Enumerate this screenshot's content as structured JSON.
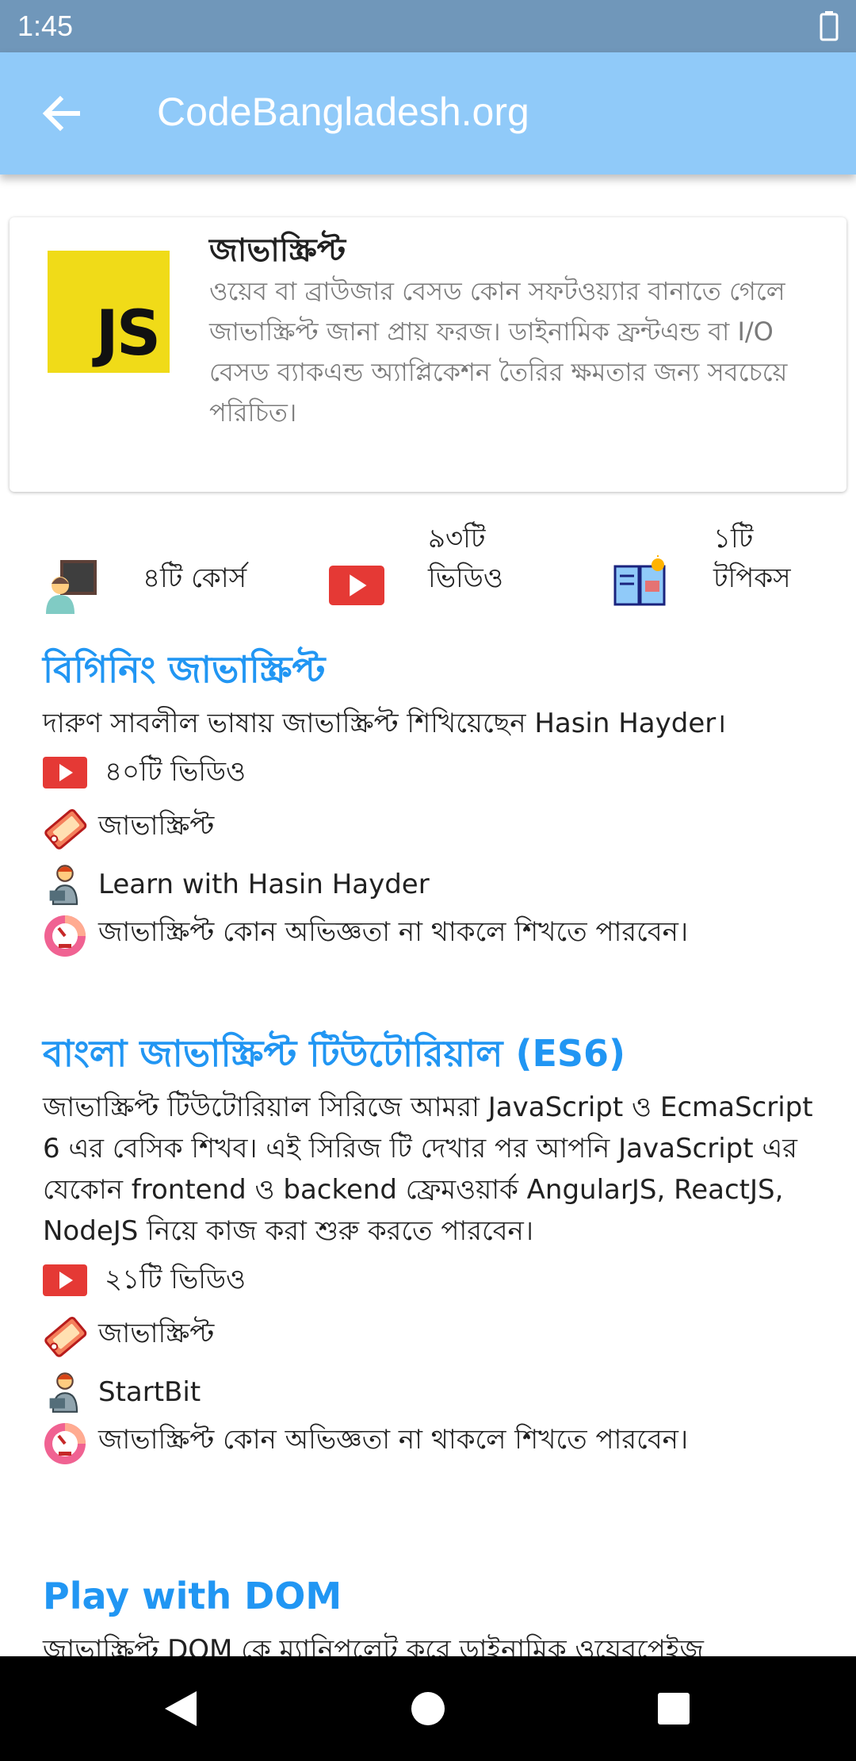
{
  "status_bar": {
    "time": "1:45",
    "battery_icon": "battery-icon"
  },
  "app_bar": {
    "back_icon": "arrow-back-icon",
    "title": "CodeBangladesh.org"
  },
  "intro": {
    "logo_text": "JS",
    "title": "জাভাস্ক্রিপ্ট",
    "description": "ওয়েব বা ব্রাউজার বেসড কোন সফটওয়্যার বানাতে গেলে জাভাস্ক্রিপ্ট জানা প্রায় ফরজ। ডাইনামিক ফ্রন্টএন্ড বা I/O বেসড ব্যাকএন্ড অ্যাপ্লিকেশন তৈরির ক্ষমতার জন্য সবচেয়ে পরিচিত।"
  },
  "stats": [
    {
      "icon": "teacher-icon",
      "label": "৪টি কোর্স"
    },
    {
      "icon": "youtube-icon",
      "label": "৯৩টি ভিডিও"
    },
    {
      "icon": "book-idea-icon",
      "label": "১টি টপিকস"
    }
  ],
  "courses": [
    {
      "title": "বিগিনিং জাভাস্ক্রিপ্ট",
      "description": "দারুণ সাবলীল ভাষায় জাভাস্ক্রিপ্ট শিখিয়েছেন Hasin Hayder।",
      "videos": "৪০টি ভিডিও",
      "tag": "জাভাস্ক্রিপ্ট",
      "author": "Learn with Hasin Hayder",
      "level": "জাভাস্ক্রিপ্ট কোন অভিজ্ঞতা না থাকলে শিখতে পারবেন।"
    },
    {
      "title": "বাংলা জাভাস্ক্রিপ্ট টিউটোরিয়াল (ES6)",
      "description": "জাভাস্ক্রিপ্ট টিউটোরিয়াল সিরিজে আমরা JavaScript ও EcmaScript 6 এর বেসিক শিখব। এই সিরিজ টি দেখার পর আপনি JavaScript এর যেকোন frontend ও backend ফ্রেমওয়ার্ক AngularJS, ReactJS, NodeJS নিয়ে কাজ করা শুরু করতে পারবেন।",
      "videos": "২১টি ভিডিও",
      "tag": "জাভাস্ক্রিপ্ট",
      "author": "StartBit",
      "level": "জাভাস্ক্রিপ্ট কোন অভিজ্ঞতা না থাকলে শিখতে পারবেন।"
    },
    {
      "title": "Play with DOM",
      "description": "জাভাস্ক্রিপ্ট DOM কে ম্যানিপুলেট করে ডাইনামিক ওয়েবপেইজ"
    }
  ],
  "meta_icons": {
    "video": "youtube-icon",
    "tag": "tag-icon",
    "author": "author-icon",
    "level": "level-gauge-icon"
  },
  "colors": {
    "app_bar": "#90caf9",
    "status_bar": "#7097ba",
    "course_title": "#2196f3",
    "js_logo": "#f0db18",
    "youtube": "#e53935"
  },
  "nav_bar": {
    "back": "nav-back-icon",
    "home": "nav-home-icon",
    "recents": "nav-recents-icon"
  }
}
